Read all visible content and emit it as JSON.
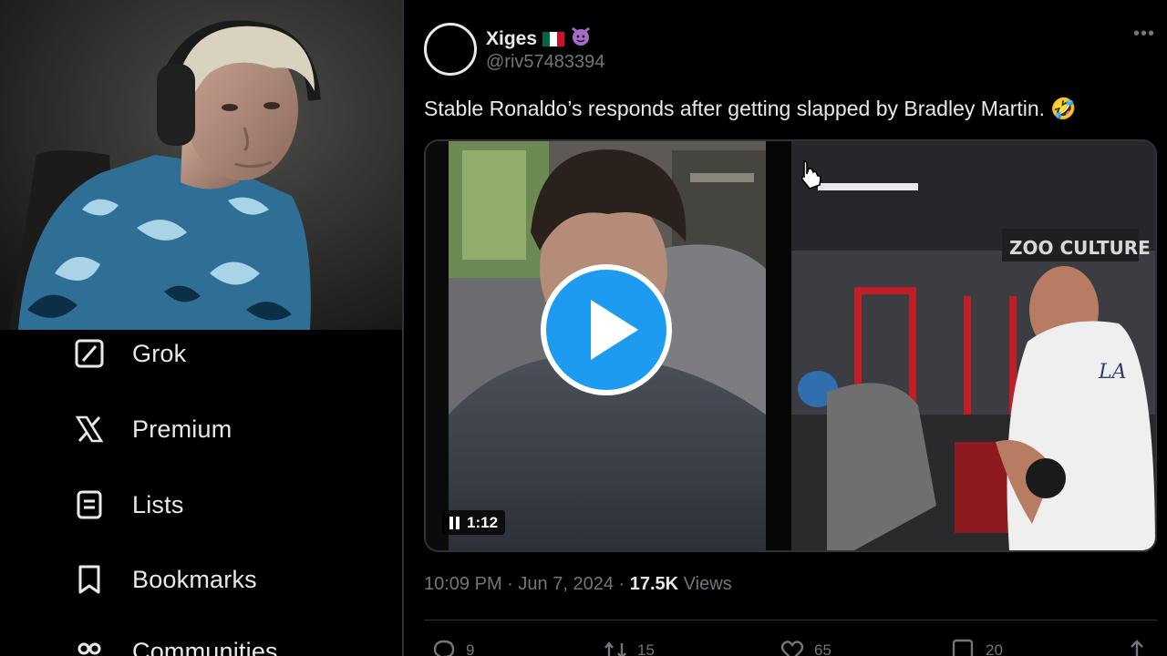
{
  "sidebar": {
    "items": [
      {
        "label": "Grok",
        "icon": "grok-icon"
      },
      {
        "label": "Premium",
        "icon": "x-logo-icon"
      },
      {
        "label": "Lists",
        "icon": "lists-icon"
      },
      {
        "label": "Bookmarks",
        "icon": "bookmark-icon"
      },
      {
        "label": "Communities",
        "icon": "communities-icon"
      }
    ]
  },
  "webcam": {
    "description_icon": "streamer-webcam"
  },
  "tweet": {
    "author": {
      "display_name": "Xiges",
      "emoji": [
        "flag-mexico",
        "smiling-imp"
      ],
      "handle": "@riv57483394"
    },
    "text": "Stable Ronaldo’s responds after getting slapped by Bradley Martin. 🤣",
    "media": {
      "type": "video",
      "duration": "1:12",
      "overlay_text": "ZOO CULTURE",
      "shirt_text": "LA"
    },
    "time": "10:09 PM",
    "date": "Jun 7, 2024",
    "views_count": "17.5K",
    "views_label": "Views",
    "separator": "·",
    "actions": {
      "replies": "9",
      "reposts": "15",
      "likes": "65",
      "bookmarks": "20"
    }
  },
  "colors": {
    "background": "#000000",
    "text_primary": "#e7e9ea",
    "text_secondary": "#71767b",
    "border": "#2f3336",
    "play_button": "#1d9bf0"
  }
}
